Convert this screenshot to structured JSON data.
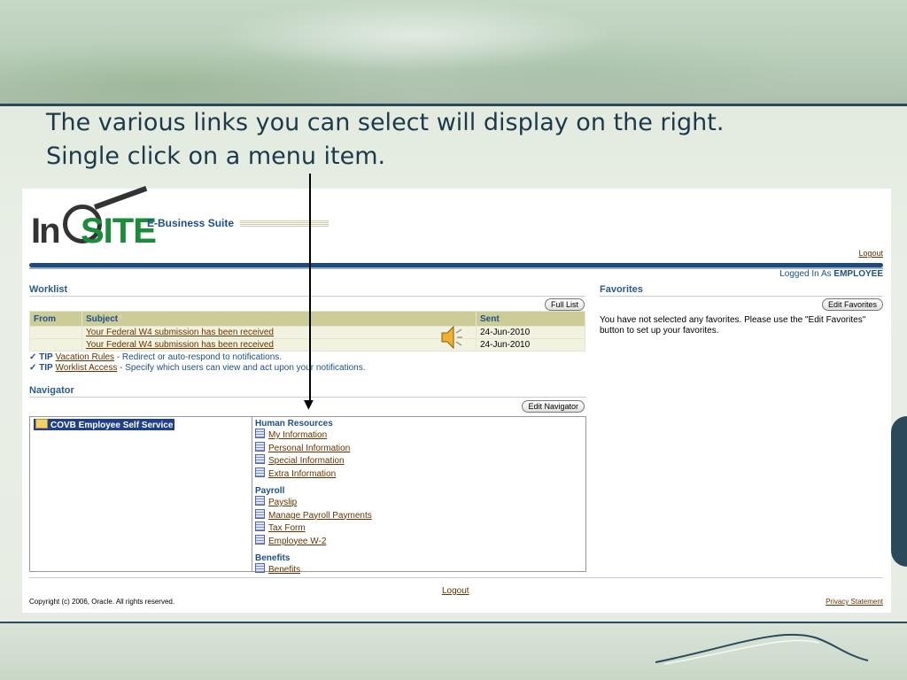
{
  "caption": {
    "line1": "The various links you can select will display on the right.",
    "line2": "Single click on a menu item."
  },
  "header": {
    "logo_part1": "In",
    "logo_part2": "SITE",
    "suite_label": "E-Business Suite",
    "logout_label": "Logout",
    "logged_in_prefix": "Logged In As",
    "user": "EMPLOYEE"
  },
  "worklist": {
    "title": "Worklist",
    "full_list_button": "Full List",
    "columns": {
      "from": "From",
      "subject": "Subject",
      "sent": "Sent"
    },
    "sort_mark": "^",
    "rows": [
      {
        "from": "",
        "subject": "Your Federal W4 submission has been received",
        "sent": "24-Jun-2010"
      },
      {
        "from": "",
        "subject": "Your Federal W4 submission has been received",
        "sent": "24-Jun-2010"
      }
    ],
    "tips": [
      {
        "label": "TIP",
        "link": "Vacation Rules",
        "text": " - Redirect or auto-respond to notifications."
      },
      {
        "label": "TIP",
        "link": "Worklist Access",
        "text": " - Specify which users can view and act upon your notifications."
      }
    ]
  },
  "favorites": {
    "title": "Favorites",
    "edit_button": "Edit Favorites",
    "empty_text": "You have not selected any favorites. Please use the \"Edit Favorites\" button to set up your favorites."
  },
  "navigator": {
    "title": "Navigator",
    "edit_button": "Edit Navigator",
    "root_item": "COVB Employee Self Service",
    "groups": [
      {
        "title": "Human Resources",
        "items": [
          "My Information",
          "Personal Information",
          "Special Information",
          "Extra Information"
        ]
      },
      {
        "title": "Payroll",
        "items": [
          "Payslip",
          "Manage Payroll Payments",
          "Tax Form",
          "Employee W-2"
        ]
      },
      {
        "title": "Benefits",
        "items": [
          "Benefits"
        ]
      }
    ]
  },
  "footer": {
    "logout_label": "Logout",
    "copyright": "Copyright (c) 2006, Oracle. All rights reserved.",
    "privacy": "Privacy Statement"
  },
  "colors": {
    "brand_green": "#1a8c3a",
    "header_blue": "#1f4b7a",
    "link_brown": "#663300",
    "table_header": "#cccc99"
  }
}
